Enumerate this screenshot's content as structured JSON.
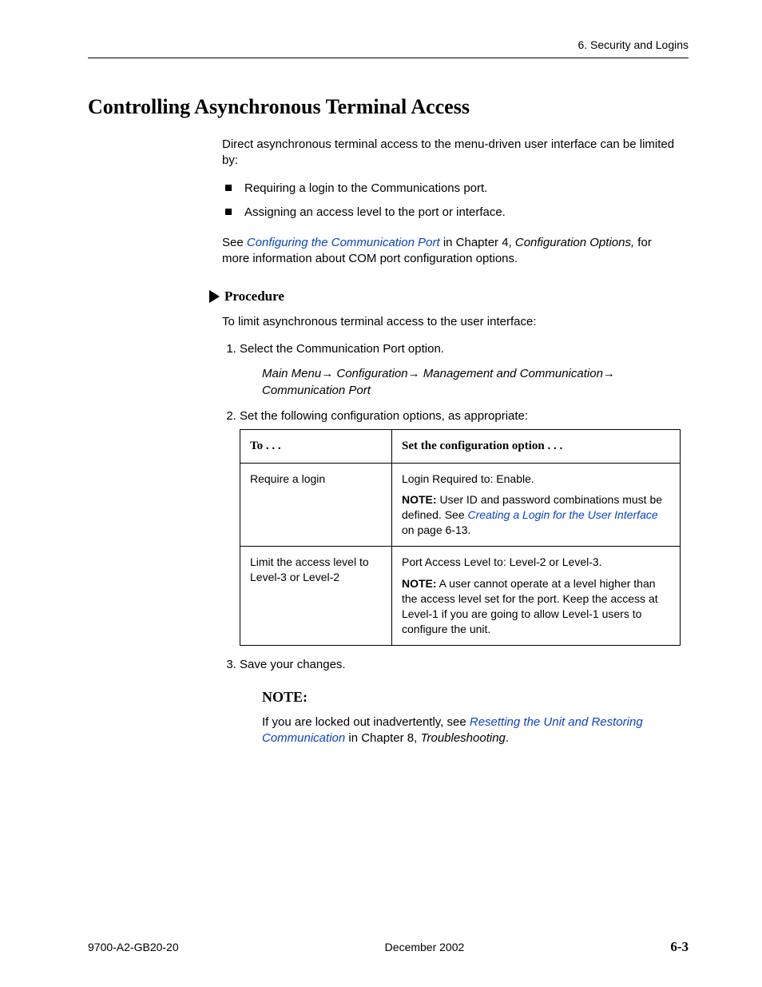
{
  "header": {
    "chapter": "6. Security and Logins"
  },
  "title": "Controlling Asynchronous Terminal Access",
  "intro": "Direct asynchronous terminal access to the menu-driven user interface can be limited by:",
  "bullets": [
    "Requiring a login to the Communications port.",
    "Assigning an access level to the port or interface."
  ],
  "see": {
    "pre": "See ",
    "link": "Configuring the Communication Port",
    "mid": " in Chapter 4, ",
    "chapter": "Configuration Options,",
    "post": " for more information about COM port configuration options."
  },
  "procedure_label": "Procedure",
  "proc_intro": "To limit asynchronous terminal access to the user interface:",
  "steps": {
    "s1": "Select the Communication Port option.",
    "path": {
      "p1": "Main Menu",
      "p2": "Configuration",
      "p3": "Management and Communication",
      "p4": "Communication Port"
    },
    "s2": "Set the following configuration options, as appropriate:",
    "s3": "Save your changes."
  },
  "table": {
    "h1": "To . . .",
    "h2": "Set the configuration option . . .",
    "r1c1": "Require a login",
    "r1c2_line1": "Login Required to:  Enable.",
    "r1c2_note_pre": "NOTE:",
    "r1c2_note_text": " User ID and password combinations must be defined. See ",
    "r1c2_link": "Creating a Login for the User Interface",
    "r1c2_note_post": " on page 6-13.",
    "r2c1": "Limit the access level to Level-3 or Level-2",
    "r2c2_line1": "Port Access Level to:  Level-2 or Level-3.",
    "r2c2_note_pre": "NOTE:",
    "r2c2_note_text": " A user cannot operate at a level higher than the access level set for the port. Keep the access at Level-1 if you are going to allow Level-1 users to configure the unit."
  },
  "note": {
    "heading": "NOTE:",
    "pre": "If you are locked out inadvertently, see ",
    "link": "Resetting the Unit and Restoring Communication",
    "mid": " in Chapter 8, ",
    "chapter": "Troubleshooting",
    "post": "."
  },
  "footer": {
    "doc": "9700-A2-GB20-20",
    "date": "December 2002",
    "page": "6-3"
  },
  "arrow": "→"
}
